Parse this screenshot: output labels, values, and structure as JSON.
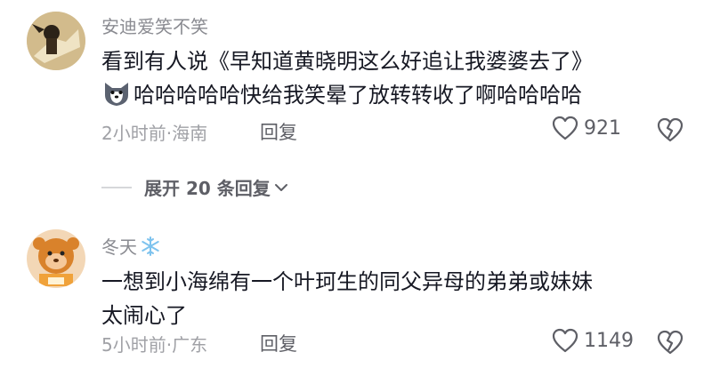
{
  "comments": [
    {
      "username": "安迪爱笑不笑",
      "lines": [
        "看到有人说《早知道黄晓明这么好追让我婆婆去了》",
        "哈哈哈哈哈快给我笑晕了放转转收了啊哈哈哈哈"
      ],
      "inline_emoji": "wolf-dog-emoji",
      "time": "2小时前",
      "location": "海南",
      "separator": "·",
      "reply_label": "回复",
      "likes": "921"
    },
    {
      "username": "冬天",
      "username_emoji": "snowflake-emoji",
      "lines": [
        "一想到小海绵有一个叶珂生的同父异母的弟弟或妹妹",
        "太闹心了"
      ],
      "time": "5小时前",
      "location": "广东",
      "separator": "·",
      "reply_label": "回复",
      "likes": "1149"
    }
  ],
  "expand_replies": {
    "label": "展开 20 条回复"
  },
  "colors": {
    "text": "#161823",
    "secondary": "#8a8b91",
    "muted": "#a0a1a6",
    "action": "#5e5f66"
  }
}
